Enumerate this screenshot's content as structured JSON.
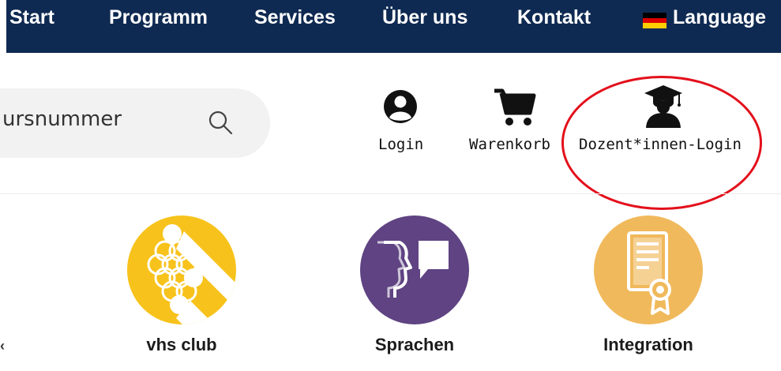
{
  "nav": {
    "items": [
      {
        "label": "Start"
      },
      {
        "label": "Programm"
      },
      {
        "label": "Services"
      },
      {
        "label": "Über uns"
      },
      {
        "label": "Kontakt"
      }
    ],
    "language_label": "Language",
    "colors": {
      "background": "#0f2a52",
      "text": "#ffffff"
    }
  },
  "search": {
    "value": "ursnummer",
    "icon": "search-icon"
  },
  "utilities": {
    "login_label": "Login",
    "cart_label": "Warenkorb",
    "teacher_login_label": "Dozent*innen-Login"
  },
  "categories": [
    {
      "label": "vhs club",
      "color": "#f7c21b"
    },
    {
      "label": "Sprachen",
      "color": "#5f4382"
    },
    {
      "label": "Integration",
      "color": "#f0b95b"
    }
  ],
  "left_fragment": "‹",
  "annotation_color": "#e3101b"
}
